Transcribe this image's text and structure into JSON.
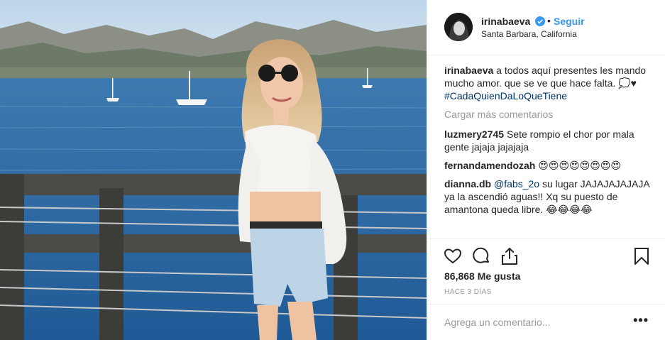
{
  "post": {
    "username": "irinabaeva",
    "follow_label": "Seguir",
    "location": "Santa Barbara, California",
    "caption": {
      "username": "irinabaeva",
      "text": "a todos aquí presentes les mando mucho amor. que se ve que hace falta. 💭♥",
      "hashtag": "#CadaQuienDaLoQueTiene"
    },
    "load_more_label": "Cargar más comentarios",
    "comments": [
      {
        "username": "luzmery2745",
        "text": "Sete rompio el chor por mala gente jajaja jajajaja"
      },
      {
        "username": "fernandamendozah",
        "text": "😍😍😍😍😍😍😍😍"
      },
      {
        "username": "dianna.db",
        "mention": "@fabs_2o",
        "text": "su lugar JAJAJAJAJAJA ya la ascendió aguas!! Xq su puesto de amantona queda libre. 😂😂😂😂"
      }
    ],
    "likes": "86,868 Me gusta",
    "time_ago": "HACE 3 DÍAS",
    "add_comment_placeholder": "Agrega un comentario...",
    "more_options": "•••",
    "icons": {
      "like": "heart-icon",
      "comment": "comment-bubble-icon",
      "share": "share-icon",
      "save": "bookmark-icon",
      "verified": "verified-badge-icon"
    },
    "colors": {
      "link": "#3897f0",
      "hashtag": "#003569",
      "muted": "#999999",
      "text": "#262626"
    }
  }
}
